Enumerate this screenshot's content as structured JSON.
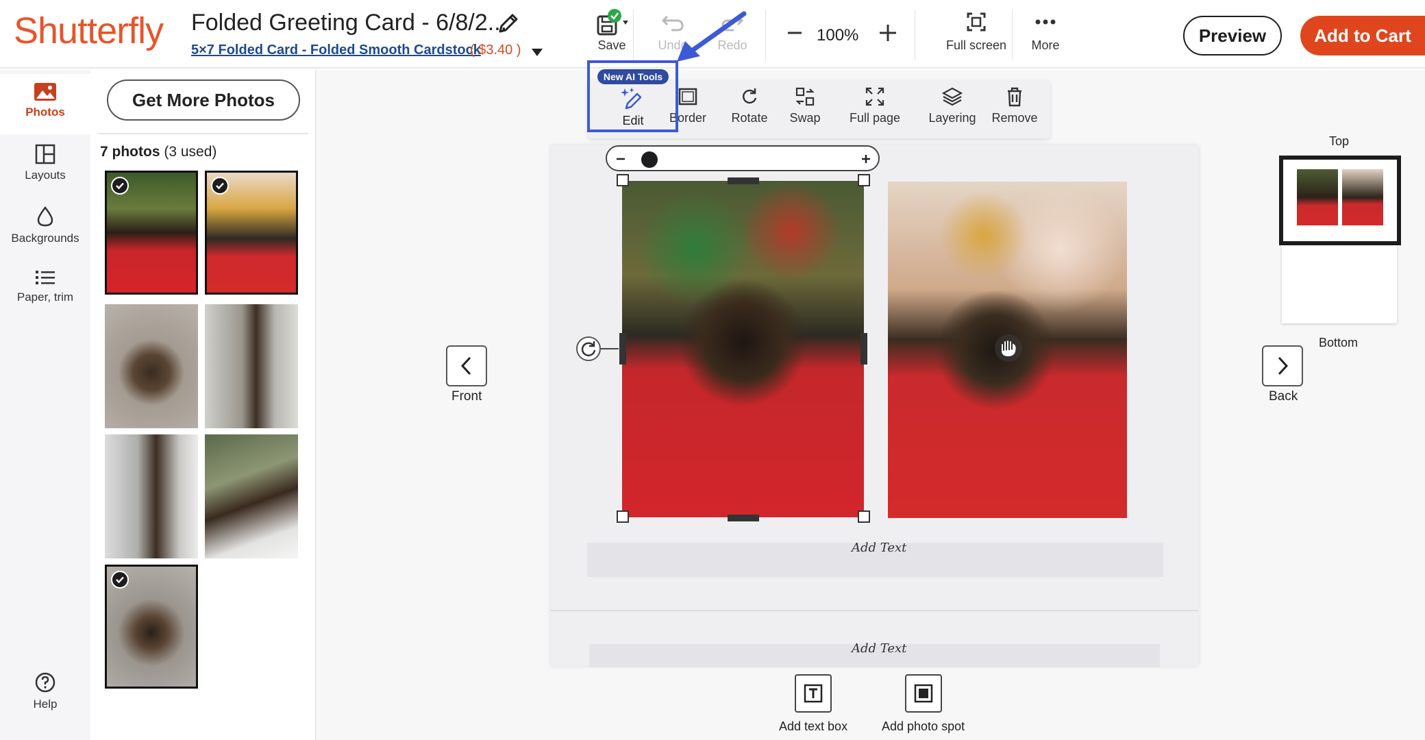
{
  "header": {
    "logo": "Shutterfly",
    "title": "Folded Greeting Card - 6/8/2...",
    "product": "5×7 Folded Card - Folded Smooth Cardstock",
    "price": "( $3.40 )",
    "toolbar": {
      "save": "Save",
      "undo": "Undo",
      "redo": "Redo",
      "zoom": "100%",
      "fullscreen": "Full screen",
      "more": "More"
    },
    "preview": "Preview",
    "add_to_cart": "Add to Cart"
  },
  "rail": {
    "items": [
      {
        "label": "Photos",
        "icon": "image-icon",
        "active": true
      },
      {
        "label": "Layouts",
        "icon": "layout-icon"
      },
      {
        "label": "Backgrounds",
        "icon": "drop-icon"
      },
      {
        "label": "Paper, trim",
        "icon": "list-icon"
      }
    ],
    "help": "Help"
  },
  "photos_panel": {
    "get_more": "Get More Photos",
    "count": "7 photos",
    "used": "(3 used)",
    "photos": [
      {
        "used": true
      },
      {
        "used": true
      },
      {
        "used": false
      },
      {
        "used": false
      },
      {
        "used": false
      },
      {
        "used": false
      },
      {
        "used": true
      }
    ]
  },
  "photo_toolbar": {
    "badge": "New AI Tools",
    "edit": "Edit",
    "border": "Border",
    "rotate": "Rotate",
    "swap": "Swap",
    "full_page": "Full page",
    "layering": "Layering",
    "remove": "Remove"
  },
  "canvas": {
    "add_text_top": "Add Text",
    "add_text_bottom": "Add Text",
    "front": "Front",
    "back": "Back",
    "page_top": "Top",
    "page_bottom": "Bottom"
  },
  "bottom_tools": {
    "add_text_box": "Add text box",
    "add_photo_spot": "Add photo spot"
  },
  "colors": {
    "brand": "#e8542a",
    "cart": "#e0461e",
    "highlight": "#3d5ad6",
    "badge": "#2f4a9e"
  }
}
